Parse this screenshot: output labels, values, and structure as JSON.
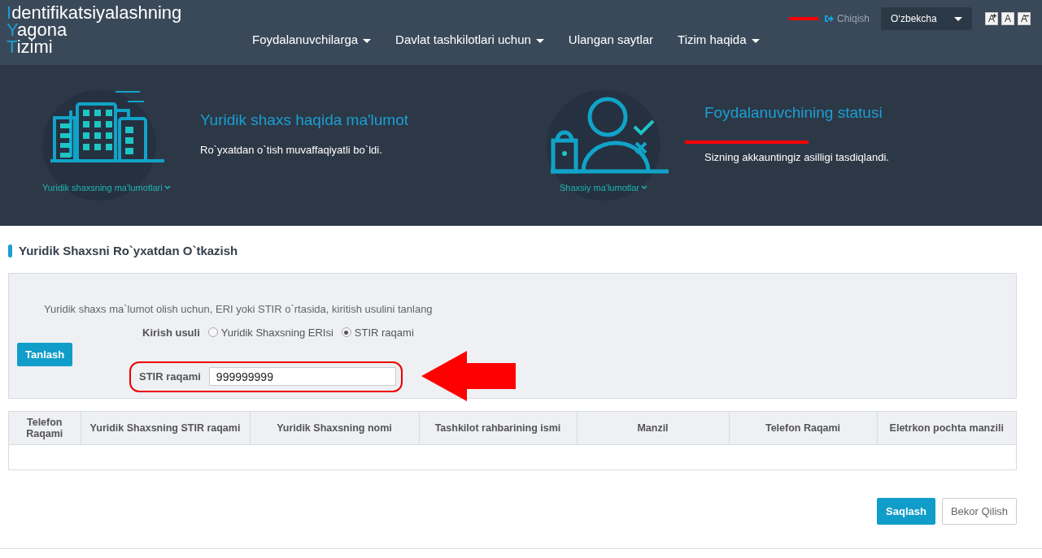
{
  "logo": {
    "lines": [
      "Identifikatsiyalashning",
      "Yagona",
      "Tizimi"
    ]
  },
  "nav": [
    {
      "label": "Foydalanuvchilarga",
      "dropdown": true
    },
    {
      "label": "Davlat tashkilotlari uchun",
      "dropdown": true
    },
    {
      "label": "Ulangan saytlar",
      "dropdown": false
    },
    {
      "label": "Tizim haqida",
      "dropdown": true
    }
  ],
  "user": {
    "redacted": true
  },
  "logout": "Chiqish",
  "language": "O‘zbekcha",
  "font_sizes": [
    "A",
    "A",
    "A"
  ],
  "cards": [
    {
      "kind": "building",
      "caption": "Yuridik shaxsning ma'lumotlari",
      "title": "Yuridik shaxs haqida ma'lumot",
      "lines": [
        {
          "text": "Ro`yxatdan o`tish muvaffaqiyatli bo`ldi.",
          "redacted": false
        }
      ]
    },
    {
      "kind": "person",
      "caption": "Shaxsiy ma'lumotlar",
      "title": "Foydalanuvchining statusi",
      "lines": [
        {
          "redacted": true
        },
        {
          "text": "Sizning akkauntingiz asilligi tasdiqlandi.",
          "redacted": false
        }
      ]
    }
  ],
  "section_title": "Yuridik Shaxsni Ro`yxatdan O`tkazish",
  "form": {
    "hint": "Yuridik shaxs ma`lumot olish uchun, ERI yoki STIR o`rtasida, kiritish usulini tanlang",
    "method_label": "Kirish usuli",
    "methods": [
      {
        "label": "Yuridik Shaxsning ERIsi",
        "selected": false
      },
      {
        "label": "STIR raqami",
        "selected": true
      }
    ],
    "select_button": "Tanlash",
    "stir_label": "STIR raqami",
    "stir_value": "999999999",
    "highlighted": true
  },
  "table": {
    "columns": [
      "Telefon Raqami",
      "Yuridik Shaxsning STIR raqami",
      "Yuridik Shaxsning nomi",
      "Tashkilot rahbarining ismi",
      "Manzil",
      "Telefon Raqami",
      "Eletrkon pochta manzili"
    ]
  },
  "buttons": [
    {
      "label": "Saqlash",
      "kind": "primary"
    },
    {
      "label": "Bekor Qilish",
      "kind": "secondary"
    }
  ]
}
